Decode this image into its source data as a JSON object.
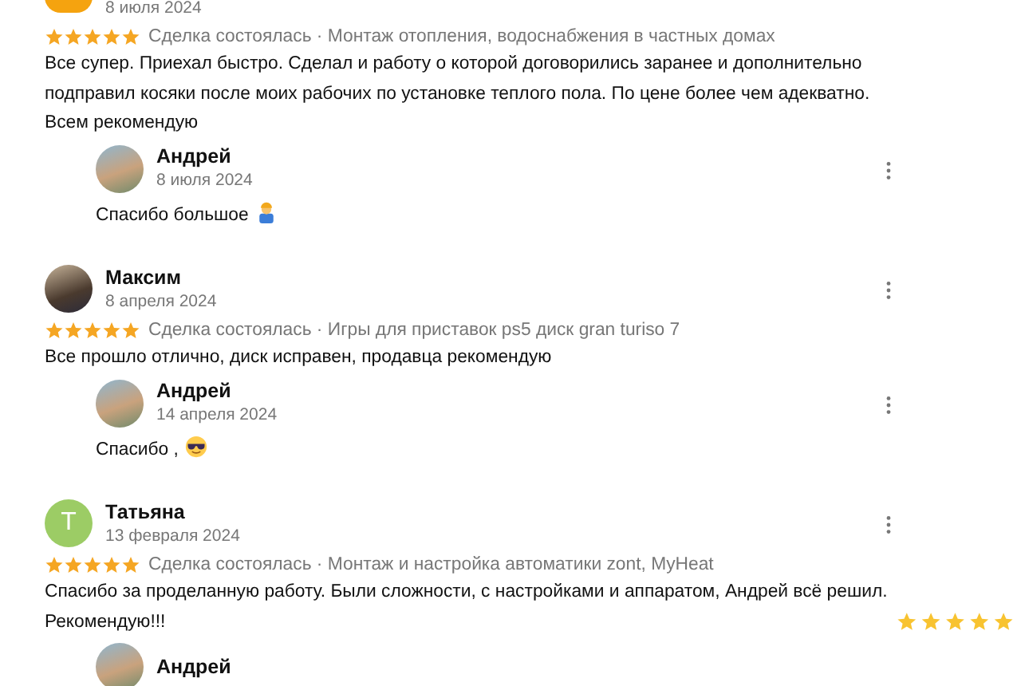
{
  "reviews": [
    {
      "date": "8 июля 2024",
      "avatar": {
        "kind": "orange"
      },
      "stars": 5,
      "deal": "Сделка состоялась · Монтаж отопления, водоснабжения в частных домах",
      "text": "Все супер. Приехал быстро. Сделал и работу о которой договорились заранее и дополнительно подправил косяки после моих рабочих по установке теплого пола. По цене более чем адекватно. Всем рекомендую",
      "reply": {
        "author": "Андрей",
        "date": "8 июля 2024",
        "text": "Спасибо большое",
        "emoji": {
          "kind": "worker"
        }
      }
    },
    {
      "author": "Максим",
      "date": "8 апреля 2024",
      "avatar": {
        "kind": "photo"
      },
      "stars": 5,
      "deal": "Сделка состоялась · Игры для приставок ps5 диск gran turiso 7",
      "text": "Все прошло отлично, диск исправен, продавца рекомендую",
      "reply": {
        "author": "Андрей",
        "date": "14 апреля 2024",
        "text": "Спасибо ,",
        "emoji": {
          "kind": "sunglasses"
        }
      }
    },
    {
      "author": "Татьяна",
      "date": "13 февраля 2024",
      "avatar": {
        "kind": "letter",
        "letter": "Т",
        "color": "#9ccc65"
      },
      "stars": 5,
      "deal": "Сделка состоялась · Монтаж и настройка автоматики zont, MyHeat",
      "text": "Спасибо за проделанную работу. Были сложности, с настройками и аппаратом, Андрей всё решил. Рекомендую!!!",
      "emoji": {
        "kind": "stars"
      },
      "reply": {
        "author": "Андрей"
      }
    }
  ]
}
